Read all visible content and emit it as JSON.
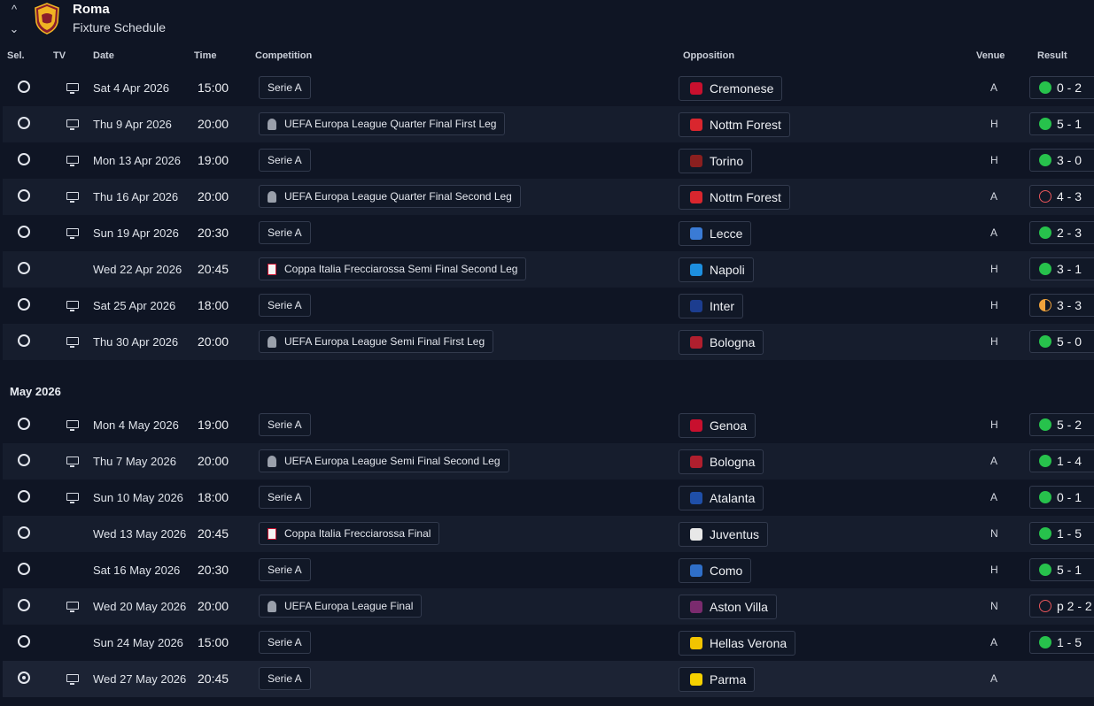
{
  "header": {
    "club_name": "Roma",
    "page_title": "Fixture Schedule",
    "up_arrow": "^",
    "down_arrow": "⌄"
  },
  "columns": {
    "sel": "Sel.",
    "tv": "TV",
    "date": "Date",
    "time": "Time",
    "competition": "Competition",
    "opposition": "Opposition",
    "venue": "Venue",
    "result": "Result"
  },
  "month_heading": "May 2026",
  "colors": {
    "background": "#0f1524",
    "row_alt": "#161d2d",
    "win": "#27c24c",
    "loss": "#e8555a",
    "draw": "#f0a23b"
  },
  "fixtures": [
    {
      "selected": false,
      "tv": true,
      "date": "Sat 4 Apr 2026",
      "time": "15:00",
      "competition": "Serie A",
      "comp_icon": "",
      "opponent": "Cremonese",
      "badge_color": "#c8102e",
      "venue": "A",
      "result": "0 - 2",
      "outcome": "win"
    },
    {
      "selected": false,
      "tv": true,
      "date": "Thu 9 Apr 2026",
      "time": "20:00",
      "competition": "UEFA Europa League Quarter Final First Leg",
      "comp_icon": "uel",
      "opponent": "Nottm Forest",
      "badge_color": "#d9262e",
      "venue": "H",
      "result": "5 - 1",
      "outcome": "win"
    },
    {
      "selected": false,
      "tv": true,
      "date": "Mon 13 Apr 2026",
      "time": "19:00",
      "competition": "Serie A",
      "comp_icon": "",
      "opponent": "Torino",
      "badge_color": "#8a1f1f",
      "venue": "H",
      "result": "3 - 0",
      "outcome": "win"
    },
    {
      "selected": false,
      "tv": true,
      "date": "Thu 16 Apr 2026",
      "time": "20:00",
      "competition": "UEFA Europa League Quarter Final Second Leg",
      "comp_icon": "uel",
      "opponent": "Nottm Forest",
      "badge_color": "#d9262e",
      "venue": "A",
      "result": "4 - 3",
      "outcome": "loss"
    },
    {
      "selected": false,
      "tv": true,
      "date": "Sun 19 Apr 2026",
      "time": "20:30",
      "competition": "Serie A",
      "comp_icon": "",
      "opponent": "Lecce",
      "badge_color": "#3a7bd5",
      "venue": "A",
      "result": "2 - 3",
      "outcome": "win"
    },
    {
      "selected": false,
      "tv": false,
      "date": "Wed 22 Apr 2026",
      "time": "20:45",
      "competition": "Coppa Italia Frecciarossa Semi Final Second Leg",
      "comp_icon": "cup",
      "opponent": "Napoli",
      "badge_color": "#1d8fe0",
      "venue": "H",
      "result": "3 - 1",
      "outcome": "win"
    },
    {
      "selected": false,
      "tv": true,
      "date": "Sat 25 Apr 2026",
      "time": "18:00",
      "competition": "Serie A",
      "comp_icon": "",
      "opponent": "Inter",
      "badge_color": "#1c3d8f",
      "venue": "H",
      "result": "3 - 3",
      "outcome": "draw"
    },
    {
      "selected": false,
      "tv": true,
      "date": "Thu 30 Apr 2026",
      "time": "20:00",
      "competition": "UEFA Europa League Semi Final First Leg",
      "comp_icon": "uel",
      "opponent": "Bologna",
      "badge_color": "#b01f2e",
      "venue": "H",
      "result": "5 - 0",
      "outcome": "win"
    },
    {
      "selected": false,
      "tv": true,
      "date": "Mon 4 May 2026",
      "time": "19:00",
      "competition": "Serie A",
      "comp_icon": "",
      "opponent": "Genoa",
      "badge_color": "#c8102e",
      "venue": "H",
      "result": "5 - 2",
      "outcome": "win"
    },
    {
      "selected": false,
      "tv": true,
      "date": "Thu 7 May 2026",
      "time": "20:00",
      "competition": "UEFA Europa League Semi Final Second Leg",
      "comp_icon": "uel",
      "opponent": "Bologna",
      "badge_color": "#b01f2e",
      "venue": "A",
      "result": "1 - 4",
      "outcome": "win"
    },
    {
      "selected": false,
      "tv": true,
      "date": "Sun 10 May 2026",
      "time": "18:00",
      "competition": "Serie A",
      "comp_icon": "",
      "opponent": "Atalanta",
      "badge_color": "#1f4fa8",
      "venue": "A",
      "result": "0 - 1",
      "outcome": "win"
    },
    {
      "selected": false,
      "tv": false,
      "date": "Wed 13 May 2026",
      "time": "20:45",
      "competition": "Coppa Italia Frecciarossa Final",
      "comp_icon": "cup",
      "opponent": "Juventus",
      "badge_color": "#e8e8e8",
      "venue": "N",
      "result": "1 - 5",
      "outcome": "win"
    },
    {
      "selected": false,
      "tv": false,
      "date": "Sat 16 May 2026",
      "time": "20:30",
      "competition": "Serie A",
      "comp_icon": "",
      "opponent": "Como",
      "badge_color": "#2f6fc9",
      "venue": "H",
      "result": "5 - 1",
      "outcome": "win"
    },
    {
      "selected": false,
      "tv": true,
      "date": "Wed 20 May 2026",
      "time": "20:00",
      "competition": "UEFA Europa League Final",
      "comp_icon": "uel",
      "opponent": "Aston Villa",
      "badge_color": "#7a2b6e",
      "venue": "N",
      "result": "p 2 - 2",
      "outcome": "loss"
    },
    {
      "selected": false,
      "tv": false,
      "date": "Sun 24 May 2026",
      "time": "15:00",
      "competition": "Serie A",
      "comp_icon": "",
      "opponent": "Hellas Verona",
      "badge_color": "#f2c400",
      "venue": "A",
      "result": "1 - 5",
      "outcome": "win"
    },
    {
      "selected": true,
      "tv": true,
      "date": "Wed 27 May 2026",
      "time": "20:45",
      "competition": "Serie A",
      "comp_icon": "",
      "opponent": "Parma",
      "badge_color": "#f5d100",
      "venue": "A",
      "result": "",
      "outcome": ""
    }
  ]
}
